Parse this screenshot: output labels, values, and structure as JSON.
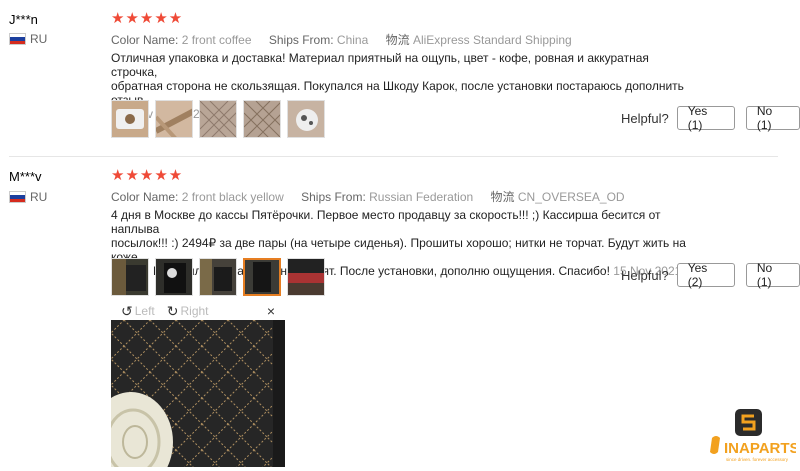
{
  "reviews": [
    {
      "user": "J***n",
      "country": "RU",
      "stars": "★★★★★",
      "color_label": "Color Name:",
      "color_value": "2 front coffee",
      "ships_label": "Ships From:",
      "ships_value": "China",
      "shipping_label": "物流",
      "shipping_value": "AliExpress Standard Shipping",
      "text_line1": "Отличная упаковка и доставка! Материал приятный на ощупь, цвет - кофе, ровная и аккуратная строчка,",
      "text_line2": "обратная сторона не скользящая. Покупался на Шкоду Карок, после установки постараюсь дополнить отзыв.",
      "date": "30 Nov 2021 02:30",
      "helpful_label": "Helpful?",
      "yes_label": "Yes (1)",
      "no_label": "No (1)"
    },
    {
      "user": "M***v",
      "country": "RU",
      "stars": "★★★★★",
      "color_label": "Color Name:",
      "color_value": "2 front black yellow",
      "ships_label": "Ships From:",
      "ships_value": "Russian Federation",
      "shipping_label": "物流",
      "shipping_value": "CN_OVERSEA_OD",
      "text_line1": "4 дня в Москве до кассы Пятёрочки. Первое место продавцу за скорость!!! ;) Кассирша бесится от наплыва",
      "text_line2": "посылок!!! :) 2494₽ за две пары (на четыре сиденья). Прошиты хорошо; нитки не торчат. Будут жить на коже",
      "text_line3": "Toyota. Поверил отзывам, что не елозят. После установки, дополню ощущения. Спасибо!",
      "date": "15 Nov 2021 06:26",
      "helpful_label": "Helpful?",
      "yes_label": "Yes (2)",
      "no_label": "No (1)"
    }
  ],
  "viewer": {
    "left_label": "Left",
    "right_label": "Right",
    "close": "×"
  },
  "colors": {
    "star": "#ef4a37",
    "active_thumb": "#e67e22",
    "logo": "#f2a11f"
  }
}
